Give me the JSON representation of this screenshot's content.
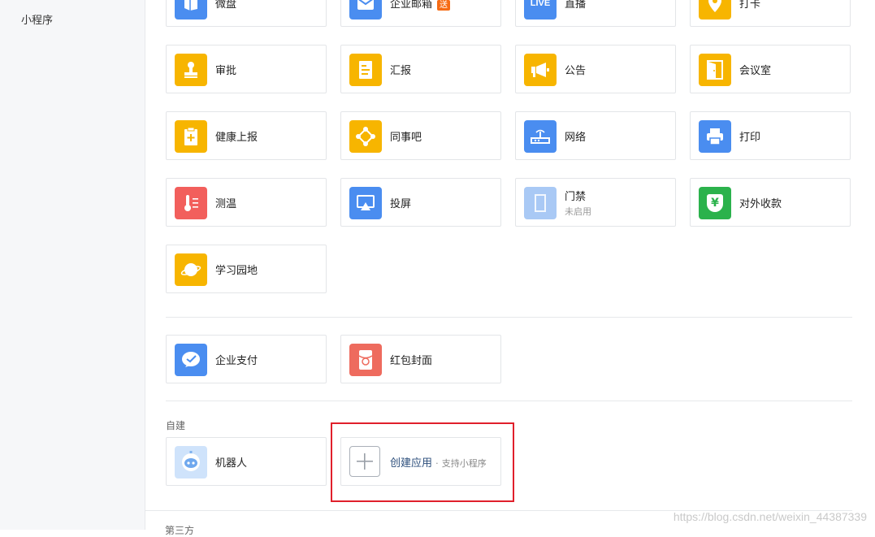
{
  "sidebar": {
    "item": "小程序"
  },
  "apps": [
    {
      "label": "微盘",
      "icon": "folder-icon",
      "color": "#4a8df0"
    },
    {
      "label": "企业邮箱",
      "icon": "mail-icon",
      "color": "#4a8df0",
      "badge": "送"
    },
    {
      "label": "直播",
      "icon": "live-icon",
      "color": "#4a8df0",
      "icon_text": "LIVE"
    },
    {
      "label": "打卡",
      "icon": "location-pin-icon",
      "color": "#f7b500"
    },
    {
      "label": "审批",
      "icon": "stamp-icon",
      "color": "#f7b500"
    },
    {
      "label": "汇报",
      "icon": "report-icon",
      "color": "#f7b500"
    },
    {
      "label": "公告",
      "icon": "megaphone-icon",
      "color": "#f7b500"
    },
    {
      "label": "会议室",
      "icon": "door-icon",
      "color": "#f7b500"
    },
    {
      "label": "健康上报",
      "icon": "health-report-icon",
      "color": "#f7b500"
    },
    {
      "label": "同事吧",
      "icon": "network-nodes-icon",
      "color": "#f7b500"
    },
    {
      "label": "网络",
      "icon": "router-icon",
      "color": "#4a8df0"
    },
    {
      "label": "打印",
      "icon": "printer-icon",
      "color": "#4a8df0"
    },
    {
      "label": "测温",
      "icon": "thermometer-icon",
      "color": "#f25f5c"
    },
    {
      "label": "投屏",
      "icon": "screen-cast-icon",
      "color": "#4a8df0"
    },
    {
      "label": "门禁",
      "icon": "door-access-icon",
      "color": "#a9c9f5",
      "sub": "未启用"
    },
    {
      "label": "对外收款",
      "icon": "yuan-shield-icon",
      "color": "#2bb24c",
      "icon_text": "¥"
    },
    {
      "label": "学习园地",
      "icon": "planet-icon",
      "color": "#f7b500"
    }
  ],
  "payments": [
    {
      "label": "企业支付",
      "icon": "wechat-pay-icon",
      "color": "#4a8df0"
    },
    {
      "label": "红包封面",
      "icon": "red-packet-icon",
      "color": "#ee6b5e"
    }
  ],
  "custom": {
    "section_title": "自建",
    "robot": {
      "label": "机器人",
      "icon": "robot-icon"
    },
    "create": {
      "label": "创建应用",
      "separator": "·",
      "sub": "支持小程序",
      "icon": "plus-icon"
    }
  },
  "watermark": "https://blog.csdn.net/weixin_44387339",
  "next_section_partial": "第三方"
}
